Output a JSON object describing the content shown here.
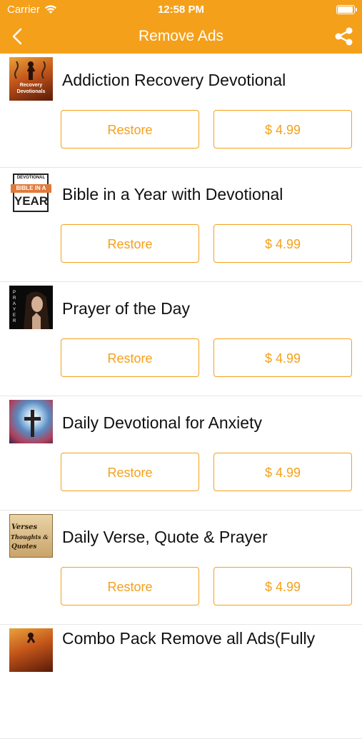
{
  "status_bar": {
    "carrier": "Carrier",
    "time": "12:58 PM",
    "battery_level": 0.95
  },
  "nav": {
    "title": "Remove Ads",
    "back_icon": "chevron-left-icon",
    "share_icon": "share-icon"
  },
  "colors": {
    "accent": "#f5a01a",
    "text": "#111111",
    "divider": "#e6e6e6"
  },
  "items": [
    {
      "title": "Addiction Recovery Devotional",
      "thumb_caption": "Recovery Devotionals",
      "restore_label": "Restore",
      "price_label": "$ 4.99"
    },
    {
      "title": "Bible in a Year with Devotional",
      "thumb_caption_top": "DEVOTIONAL",
      "thumb_caption_mid": "BIBLE IN A",
      "thumb_caption_bottom": "YEAR",
      "restore_label": "Restore",
      "price_label": "$ 4.99"
    },
    {
      "title": "Prayer of the Day",
      "thumb_caption": "PRAYER",
      "restore_label": "Restore",
      "price_label": "$ 4.99"
    },
    {
      "title": "Daily Devotional for Anxiety",
      "restore_label": "Restore",
      "price_label": "$ 4.99"
    },
    {
      "title": "Daily Verse, Quote & Prayer",
      "thumb_caption_1": "Verses",
      "thumb_caption_2": "Thoughts &",
      "thumb_caption_3": "Quotes",
      "restore_label": "Restore",
      "price_label": "$ 4.99"
    },
    {
      "title": "Combo Pack Remove all Ads(Fully"
    }
  ]
}
